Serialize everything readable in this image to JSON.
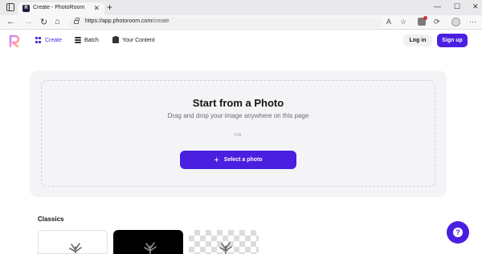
{
  "browser": {
    "tab_title": "Create - PhotoRoom",
    "tab_favicon_letter": "R",
    "url_host": "https://app.photoroom.com",
    "url_path": "/create",
    "controls": {
      "minimize": "—",
      "maximize": "☐",
      "close": "✕",
      "new_tab": "+"
    }
  },
  "header": {
    "nav": [
      {
        "label": "Create",
        "icon": "grid-icon",
        "active": true
      },
      {
        "label": "Batch",
        "icon": "layers-icon",
        "active": false
      },
      {
        "label": "Your Content",
        "icon": "folder-icon",
        "active": false
      }
    ],
    "login_label": "Log in",
    "signup_label": "Sign up"
  },
  "upload": {
    "title": "Start from a Photo",
    "subtitle": "Drag and drop your image anywhere on this page",
    "or_label": "OR",
    "button_label": "Select a photo"
  },
  "classics": {
    "title": "Classics",
    "thumbnails": [
      "white background",
      "black background",
      "transparent background"
    ]
  },
  "colors": {
    "accent": "#4b1fe0",
    "panel_bg": "#f4f4f7"
  }
}
